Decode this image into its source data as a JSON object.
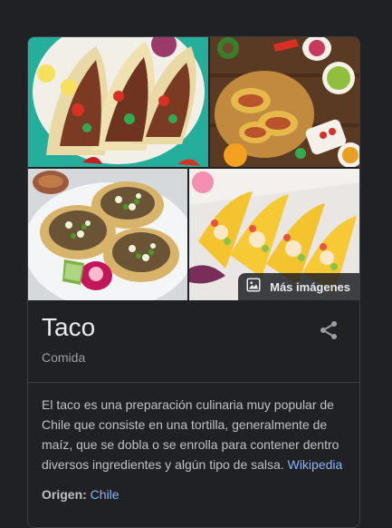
{
  "gallery": {
    "more_images_label": "Más imágenes",
    "icons": {
      "more_images": "image-icon"
    }
  },
  "entity": {
    "title": "Taco",
    "subtitle": "Comida",
    "share_icon": "share-icon"
  },
  "description": {
    "text": "El taco es una preparación culinaria muy popular de Chile que consiste en una tortilla, generalmente de maíz, que se dobla o se enrolla para contener dentro diversos ingredientes y algún tipo de salsa.",
    "source_link": "Wikipedia"
  },
  "facts": [
    {
      "key": "Origen:",
      "value": "Chile"
    }
  ],
  "colors": {
    "background": "#202124",
    "border": "#3c4043",
    "title": "#e8eaed",
    "text": "#bdc1c6",
    "muted": "#9aa0a6",
    "link": "#8ab4f8"
  }
}
